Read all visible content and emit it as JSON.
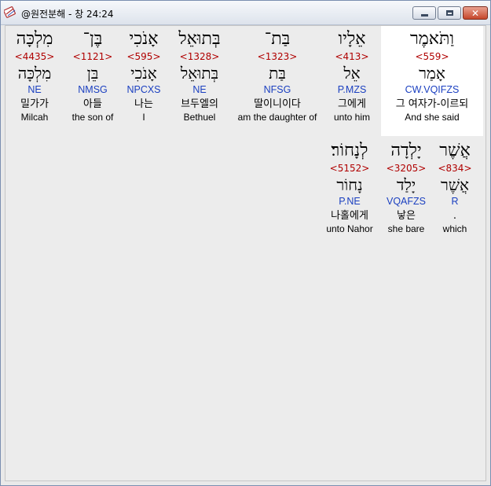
{
  "window": {
    "title": "@원전분해 - 창 24:24",
    "app_icon": "bible-app-icon",
    "buttons": {
      "minimize": "minimize-icon",
      "maximize": "maximize-icon",
      "close": "close-icon"
    }
  },
  "verse": {
    "book": "창",
    "reference": "24:24",
    "words": [
      {
        "hebrew": "וַתֹּאמֶר",
        "strong": "<559>",
        "root": "אָמַר",
        "morph": "CW.VQIFZS",
        "korean": "그 여자가-이르되",
        "english": "And she said",
        "highlighted": true
      },
      {
        "hebrew": "אֵלָיו",
        "strong": "<413>",
        "root": "אֵל",
        "morph": "P.MZS",
        "korean": "그에게",
        "english": "unto him",
        "highlighted": false
      },
      {
        "hebrew": "בַּת־",
        "strong": "<1323>",
        "root": "בַּת",
        "morph": "NFSG",
        "korean": "딸이니이다",
        "english": "am the daughter of",
        "highlighted": false
      },
      {
        "hebrew": "בְּתוּאֵל",
        "strong": "<1328>",
        "root": "בְּתוּאֵל",
        "morph": "NE",
        "korean": "브두엘의",
        "english": "Bethuel",
        "highlighted": false
      },
      {
        "hebrew": "אָנֹכִי",
        "strong": "<595>",
        "root": "אָנֹכִי",
        "morph": "NPCXS",
        "korean": "나는",
        "english": "I",
        "highlighted": false
      },
      {
        "hebrew": "בֶּן־",
        "strong": "<1121>",
        "root": "בֵּן",
        "morph": "NMSG",
        "korean": "아들",
        "english": "the son of",
        "highlighted": false
      },
      {
        "hebrew": "מִלְכָּה",
        "strong": "<4435>",
        "root": "מִלְכָּה",
        "morph": "NE",
        "korean": "밀가가",
        "english": "Milcah",
        "highlighted": false
      },
      {
        "hebrew": "אֲשֶׁר",
        "strong": "<834>",
        "root": "אֲשֶׁר",
        "morph": "R",
        "korean": ".",
        "english": "which",
        "highlighted": false
      },
      {
        "hebrew": "יָלְדָה",
        "strong": "<3205>",
        "root": "יָלַד",
        "morph": "VQAFZS",
        "korean": "낳은",
        "english": "she bare",
        "highlighted": false
      },
      {
        "hebrew": "לְנָחוֹר׃",
        "strong": "<5152>",
        "root": "נָחוֹר",
        "morph": "P.NE",
        "korean": "나홀에게",
        "english": "unto Nahor",
        "highlighted": false
      }
    ]
  },
  "colors": {
    "strong_number": "#b00000",
    "morphology": "#1a3fc0",
    "highlight_background": "#ffffff",
    "client_background": "#ececec"
  }
}
